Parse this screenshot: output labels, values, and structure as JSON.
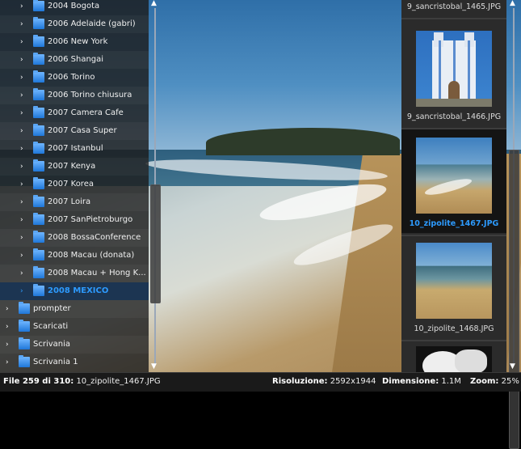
{
  "tree": {
    "items": [
      {
        "label": "2004 Bogota",
        "depth": 1
      },
      {
        "label": "2006 Adelaide (gabri)",
        "depth": 1
      },
      {
        "label": "2006 New York",
        "depth": 1
      },
      {
        "label": "2006 Shangai",
        "depth": 1
      },
      {
        "label": "2006 Torino",
        "depth": 1
      },
      {
        "label": "2006 Torino chiusura",
        "depth": 1
      },
      {
        "label": "2007 Camera Cafe",
        "depth": 1
      },
      {
        "label": "2007 Casa Super",
        "depth": 1
      },
      {
        "label": "2007 Istanbul",
        "depth": 1
      },
      {
        "label": "2007 Kenya",
        "depth": 1
      },
      {
        "label": "2007 Korea",
        "depth": 1
      },
      {
        "label": "2007 Loira",
        "depth": 1
      },
      {
        "label": "2007 SanPietroburgo",
        "depth": 1
      },
      {
        "label": "2008 BossaConference",
        "depth": 1
      },
      {
        "label": "2008 Macau (donata)",
        "depth": 1
      },
      {
        "label": "2008 Macau + Hong K...",
        "depth": 1
      },
      {
        "label": "2008 MEXICO",
        "depth": 1,
        "selected": true
      },
      {
        "label": "prompter",
        "depth": 0
      },
      {
        "label": "Scaricati",
        "depth": 0
      },
      {
        "label": "Scrivania",
        "depth": 0
      },
      {
        "label": "Scrivania 1",
        "depth": 0
      }
    ],
    "expand_glyph": "›"
  },
  "thumbnails": [
    {
      "caption": "9_sancristobal_1465.JPG",
      "kind": "none"
    },
    {
      "caption": "9_sancristobal_1466.JPG",
      "kind": "church"
    },
    {
      "caption": "10_zipolite_1467.JPG",
      "kind": "beach",
      "selected": true
    },
    {
      "caption": "10_zipolite_1468.JPG",
      "kind": "beach2"
    },
    {
      "caption": "",
      "kind": "dark"
    }
  ],
  "scroll": {
    "up": "▲",
    "down": "▼"
  },
  "status": {
    "file_label": "File 259 di 310:",
    "file_name": "10_zipolite_1467.JPG",
    "res_label": "Risoluzione:",
    "res_value": "2592x1944",
    "dim_label": "Dimensione:",
    "dim_value": "1.1M",
    "zoom_label": "Zoom:",
    "zoom_value": "25%"
  },
  "colors": {
    "accent": "#2d9bff",
    "folder": "#1f77d8"
  }
}
